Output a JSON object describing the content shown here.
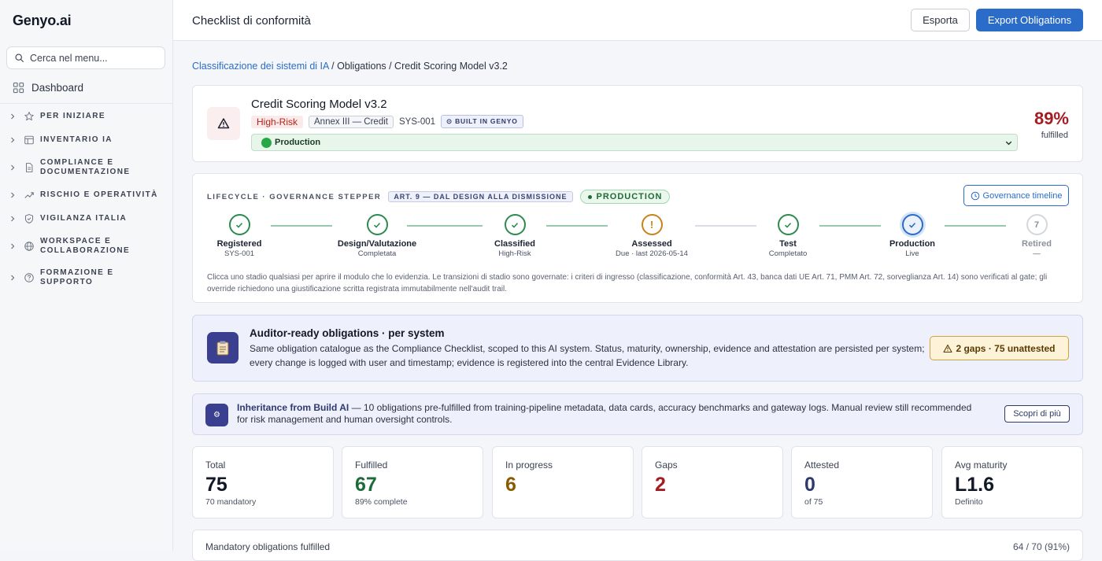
{
  "sidebar": {
    "brand": "Genyo.ai",
    "search_placeholder": "Cerca nel menu...",
    "dashboard_label": "Dashboard",
    "groups": [
      {
        "label": "PER INIZIARE",
        "icon": "star-icon"
      },
      {
        "label": "INVENTARIO IA",
        "icon": "table-icon"
      },
      {
        "label": "COMPLIANCE E DOCUMENTAZIONE",
        "icon": "document-icon"
      },
      {
        "label": "RISCHIO E OPERATIVITÀ",
        "icon": "trend-icon"
      },
      {
        "label": "VIGILANZA ITALIA",
        "icon": "shield-icon"
      },
      {
        "label": "WORKSPACE E COLLABORAZIONE",
        "icon": "globe-icon"
      },
      {
        "label": "FORMAZIONE E SUPPORTO",
        "icon": "help-icon"
      }
    ]
  },
  "header": {
    "title": "Checklist di conformità",
    "esporta_label": "Esporta",
    "export_label": "Export Obligations"
  },
  "breadcrumb": {
    "root": "Classificazione dei sistemi di IA",
    "rest": " / Obligations / Credit Scoring Model v3.2"
  },
  "system": {
    "name": "Credit Scoring Model v3.2",
    "risk": "High-Risk",
    "annex": "Annex III — Credit",
    "id": "SYS-001",
    "built": "⊙ BUILT IN GENYO",
    "stage": "Production",
    "percent": "89%",
    "percent_label": "fulfilled",
    "colors": {
      "risk": "#b42318",
      "stage": "#27a745"
    }
  },
  "lifecycle": {
    "title": "LIFECYCLE · GOVERNANCE STEPPER",
    "article": "ART. 9 — DAL DESIGN ALLA DISMISSIONE",
    "current": "PRODUCTION",
    "timeline_button": "Governance timeline",
    "stages": [
      {
        "name": "Registered",
        "sub": "SYS-001",
        "state": "done"
      },
      {
        "name": "Design/Valutazione",
        "sub": "Completata",
        "state": "done"
      },
      {
        "name": "Classified",
        "sub": "High-Risk",
        "state": "done"
      },
      {
        "name": "Assessed",
        "sub": "Due · last 2026-05-14",
        "state": "warn"
      },
      {
        "name": "Test",
        "sub": "Completato",
        "state": "done"
      },
      {
        "name": "Production",
        "sub": "Live",
        "state": "current"
      },
      {
        "name": "Retired",
        "sub": "—",
        "state": "pending",
        "number": "7"
      }
    ],
    "note": "Clicca uno stadio qualsiasi per aprire il modulo che lo evidenzia. Le transizioni di stadio sono governate: i criteri di ingresso (classificazione, conformità Art. 43, banca dati UE Art. 71, PMM Art. 72, sorveglianza Art. 14) sono verificati al gate; gli override richiedono una giustificazione scritta registrata immutabilmente nell'audit trail."
  },
  "auditor": {
    "title": "Auditor-ready obligations · per system",
    "text": "Same obligation catalogue as the Compliance Checklist, scoped to this AI system. Status, maturity, ownership, evidence and attestation are persisted per system; every change is logged with user and timestamp; evidence is registered into the central Evidence Library.",
    "badge": "2 gaps · 75 unattested"
  },
  "inheritance": {
    "title": "Inheritance from Build AI",
    "text": " — 10 obligations pre-fulfilled from training-pipeline metadata, data cards, accuracy benchmarks and gateway logs. Manual review still recommended for risk management and human oversight controls.",
    "button": "Scopri di più"
  },
  "stats": [
    {
      "label": "Total",
      "value": "75",
      "sub": "70 mandatory",
      "color": "#121826"
    },
    {
      "label": "Fulfilled",
      "value": "67",
      "sub": "89% complete",
      "color": "#1e6b3a"
    },
    {
      "label": "In progress",
      "value": "6",
      "sub": "",
      "color": "#8a5a00"
    },
    {
      "label": "Gaps",
      "value": "2",
      "sub": "",
      "color": "#a31d22"
    },
    {
      "label": "Attested",
      "value": "0",
      "sub": "of 75",
      "color": "#2e3a6e"
    },
    {
      "label": "Avg maturity",
      "value": "L1.6",
      "sub": "Definito",
      "color": "#121826"
    }
  ],
  "mandatory": {
    "label": "Mandatory obligations fulfilled",
    "value": "64 / 70 (91%)"
  }
}
